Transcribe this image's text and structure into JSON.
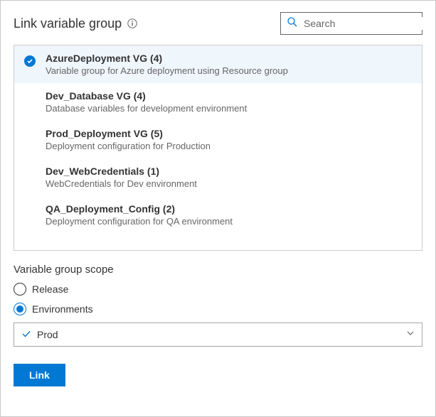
{
  "header": {
    "title": "Link variable group",
    "search_placeholder": "Search"
  },
  "groups": [
    {
      "title": "AzureDeployment VG (4)",
      "desc": "Variable group for Azure deployment using Resource group",
      "selected": true
    },
    {
      "title": "Dev_Database VG (4)",
      "desc": "Database variables for development environment",
      "selected": false
    },
    {
      "title": "Prod_Deployment VG (5)",
      "desc": "Deployment configuration for Production",
      "selected": false
    },
    {
      "title": "Dev_WebCredentials (1)",
      "desc": "WebCredentials for Dev environment",
      "selected": false
    },
    {
      "title": "QA_Deployment_Config (2)",
      "desc": "Deployment configuration for QA environment",
      "selected": false
    }
  ],
  "scope": {
    "heading": "Variable group scope",
    "release_label": "Release",
    "env_label": "Environments",
    "selected": "Environments",
    "env_value": "Prod"
  },
  "actions": {
    "link_label": "Link"
  }
}
